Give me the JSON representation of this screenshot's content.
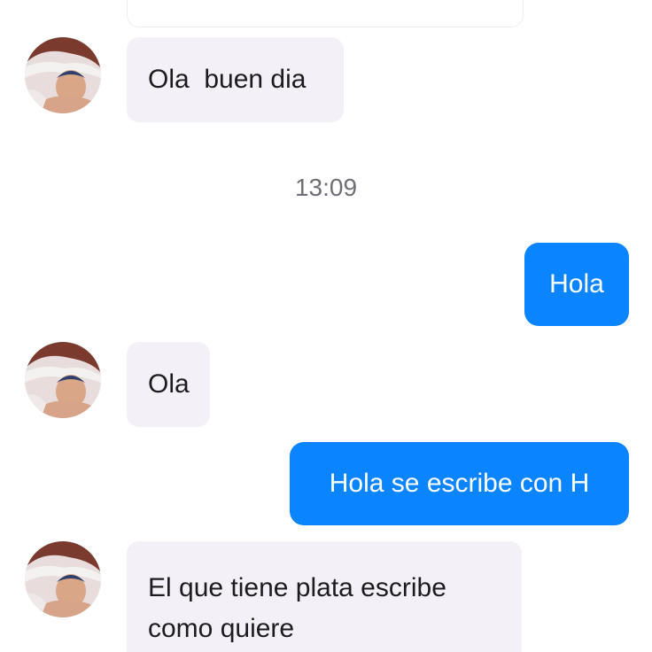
{
  "conversation": {
    "timestamp": "13:09",
    "messages": [
      {
        "direction": "incoming",
        "text": "Ola  buen dia"
      },
      {
        "direction": "outgoing",
        "text": "Hola"
      },
      {
        "direction": "incoming",
        "text": "Ola"
      },
      {
        "direction": "outgoing",
        "text": "Hola se escribe con H"
      },
      {
        "direction": "incoming",
        "text": "El que tiene plata escribe como quiere"
      }
    ]
  },
  "colors": {
    "outgoing_bubble": "#0a84ff",
    "incoming_bubble": "#f3f0f8",
    "timestamp_text": "#6f6f75"
  },
  "icons": {
    "avatar": "contact-avatar-photo"
  }
}
